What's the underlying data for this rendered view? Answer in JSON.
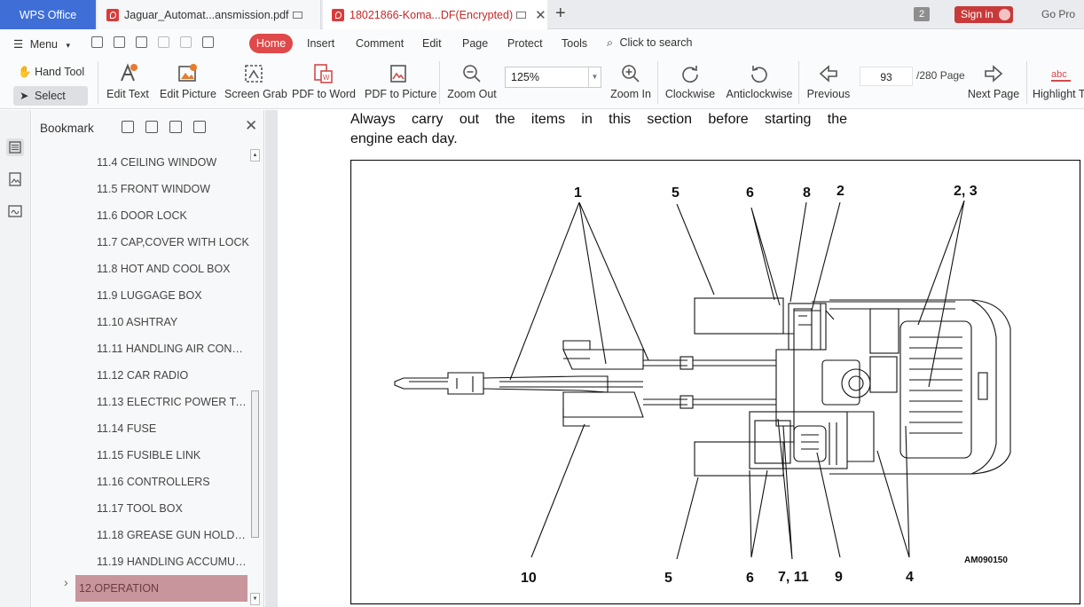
{
  "tabs": {
    "app": "WPS Office",
    "jaguar": "Jaguar_Automat...ansmission.pdf",
    "koma": "18021866-Koma...DF(Encrypted)",
    "count": "2",
    "signin": "Sign in",
    "gopro": "Go Pro"
  },
  "ribbon": {
    "menu": "Menu",
    "home": "Home",
    "insert": "Insert",
    "comment": "Comment",
    "edit": "Edit",
    "page": "Page",
    "protect": "Protect",
    "tools": "Tools",
    "search": "Click to search"
  },
  "toolbar": {
    "hand_tool": "Hand Tool",
    "select_tool": "Select Tool",
    "edit_text": "Edit Text",
    "edit_picture": "Edit Picture",
    "screen_grab": "Screen Grab",
    "pdf_to_word": "PDF to Word",
    "pdf_to_picture": "PDF to Picture",
    "zoom_out": "Zoom Out",
    "zoom_value": "125%",
    "zoom_in": "Zoom In",
    "clockwise": "Clockwise",
    "anticlockwise": "Anticlockwise",
    "previous": "Previous",
    "page_number": "93",
    "page_total": "/280 Page",
    "next_page": "Next Page",
    "highlight": "Highlight T"
  },
  "bookmarks": {
    "title": "Bookmark",
    "items": [
      "11.4 CEILING WINDOW",
      "11.5 FRONT WINDOW",
      "11.6 DOOR LOCK",
      "11.7 CAP,COVER WITH LOCK",
      "11.8 HOT AND COOL BOX",
      "11.9 LUGGAGE BOX",
      "11.10 ASHTRAY",
      "11.11 HANDLING AIR CONDITI..",
      "11.12 CAR RADIO",
      "11.13 ELECTRIC POWER TAKE-...",
      "11.14 FUSE",
      "11.15 FUSIBLE LINK",
      "11.16 CONTROLLERS",
      "11.17 TOOL BOX",
      "11.18 GREASE GUN HOLDER",
      "11.19 HANDLING ACCUMULA..."
    ],
    "selected": "12.OPERATION"
  },
  "document": {
    "line1": "Always carry out the items in this section before starting the",
    "line2": "engine each day.",
    "labels": {
      "l1": "1",
      "l5_top": "5",
      "l6_top": "6",
      "l8": "8",
      "l2": "2",
      "l23": "2, 3",
      "l10": "10",
      "l5_bot": "5",
      "l6_bot": "6",
      "l711": "7, 11",
      "l9": "9",
      "l4": "4"
    },
    "figure_code": "AM090150"
  }
}
